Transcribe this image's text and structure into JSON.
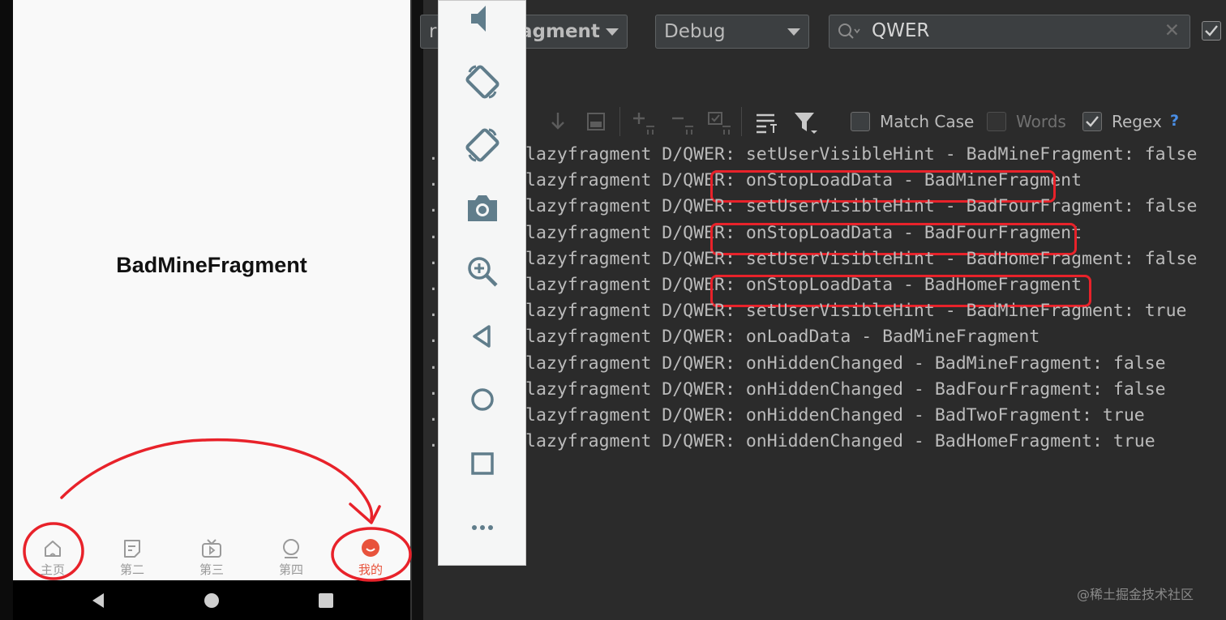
{
  "phone": {
    "fragment_title": "BadMineFragment",
    "nav": [
      {
        "label": "主页",
        "icon": "home-icon",
        "active": false
      },
      {
        "label": "第二",
        "icon": "note-icon",
        "active": false
      },
      {
        "label": "第三",
        "icon": "tv-icon",
        "active": false
      },
      {
        "label": "第四",
        "icon": "bubble-icon",
        "active": false
      },
      {
        "label": "我的",
        "icon": "person-icon",
        "active": true
      }
    ],
    "accent": "#e8533c"
  },
  "emulator_toolbar": [
    "volume-icon",
    "rotate-left-icon",
    "rotate-right-icon",
    "camera-icon",
    "zoom-in-icon",
    "back-icon",
    "home-circle-icon",
    "overview-icon",
    "more-icon"
  ],
  "filter": {
    "process_partial": "agment",
    "process_left_fragment": "r",
    "level": "Debug",
    "search": "QWER"
  },
  "options": {
    "match_case": {
      "label": "Match Case",
      "checked": false
    },
    "words": {
      "label": "Words",
      "checked": false
    },
    "regex": {
      "label": "Regex",
      "checked": true
    },
    "help": "?"
  },
  "log_lines": [
    {
      "dot": ".",
      "text": "lazyfragment D/QWER: setUserVisibleHint - BadMineFragment: false",
      "highlight": false
    },
    {
      "dot": ".",
      "text": "lazyfragment D/QWER: onStopLoadData - BadMineFragment",
      "highlight": true
    },
    {
      "dot": ".",
      "text": "lazyfragment D/QWER: setUserVisibleHint - BadFourFragment: false",
      "highlight": false
    },
    {
      "dot": ".",
      "text": "lazyfragment D/QWER: onStopLoadData - BadFourFragment",
      "highlight": true
    },
    {
      "dot": ".",
      "text": "lazyfragment D/QWER: setUserVisibleHint - BadHomeFragment: false",
      "highlight": false
    },
    {
      "dot": ".",
      "text": "lazyfragment D/QWER: onStopLoadData - BadHomeFragment",
      "highlight": true
    },
    {
      "dot": ".",
      "text": "lazyfragment D/QWER: setUserVisibleHint - BadMineFragment: true",
      "highlight": false
    },
    {
      "dot": ".",
      "text": "lazyfragment D/QWER: onLoadData - BadMineFragment",
      "highlight": false
    },
    {
      "dot": ".",
      "text": "lazyfragment D/QWER: onHiddenChanged - BadMineFragment: false",
      "highlight": false
    },
    {
      "dot": ".",
      "text": "lazyfragment D/QWER: onHiddenChanged - BadFourFragment: false",
      "highlight": false
    },
    {
      "dot": ".",
      "text": "lazyfragment D/QWER: onHiddenChanged - BadTwoFragment: true",
      "highlight": false
    },
    {
      "dot": ".",
      "text": "lazyfragment D/QWER: onHiddenChanged - BadHomeFragment: true",
      "highlight": false
    }
  ],
  "annotation_color": "#e8222a",
  "watermark": "@稀土掘金技术社区"
}
